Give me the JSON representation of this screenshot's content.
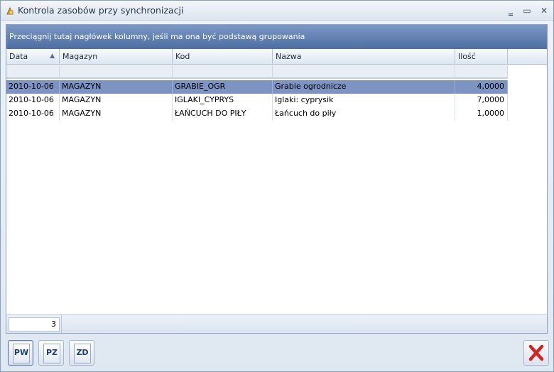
{
  "window": {
    "title": "Kontrola zasobów przy synchronizacji",
    "minimize_glyph": "‗",
    "maximize_glyph": "▭",
    "close_glyph": "✕"
  },
  "grid": {
    "group_hint": "Przeciągnij tutaj nagłówek kolumny, jeśli ma ona być podstawą grupowania",
    "sort_indicator": "▲",
    "columns": [
      "Data",
      "Magazyn",
      "Kod",
      "Nazwa",
      "Ilość"
    ],
    "rows": [
      [
        "2010-10-06",
        "MAGAZYN",
        "GRABIE_OGR",
        "Grabie ogrodnicze",
        "4,0000"
      ],
      [
        "2010-10-06",
        "MAGAZYN",
        "IGLAKI_CYPRYS",
        "Iglaki: cyprysik",
        "7,0000"
      ],
      [
        "2010-10-06",
        "MAGAZYN",
        "ŁAŃCUCH DO PIŁY",
        "Łańcuch do piły",
        "1,0000"
      ]
    ],
    "selected_row": 0,
    "selection_color": "#7d93c4",
    "record_count": "3"
  },
  "toolbar": {
    "buttons": [
      {
        "label": "PW",
        "icon": "document-pw-icon"
      },
      {
        "label": "PZ",
        "icon": "document-pz-icon"
      },
      {
        "label": "ZD",
        "icon": "document-zd-icon"
      }
    ],
    "close_icon": "red-x-icon",
    "close_color": "#d42121"
  }
}
